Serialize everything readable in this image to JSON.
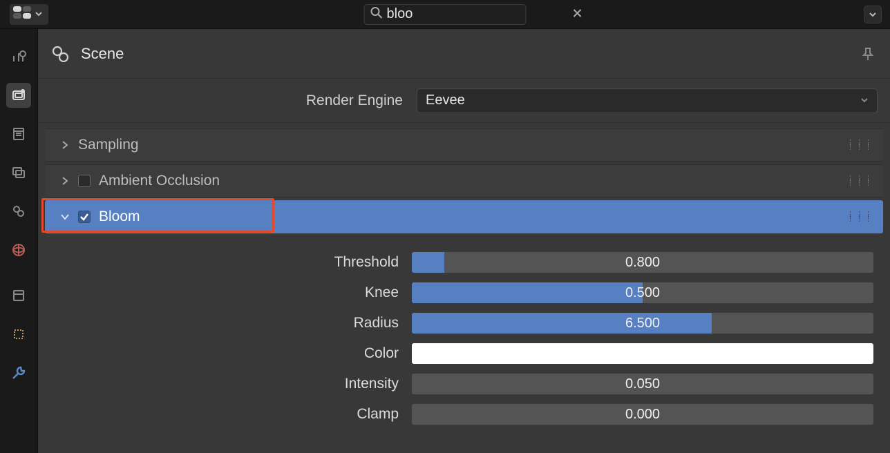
{
  "search": {
    "value": "bloo"
  },
  "context": {
    "title": "Scene"
  },
  "engine": {
    "label": "Render Engine",
    "value": "Eevee"
  },
  "panels": {
    "sampling": {
      "title": "Sampling"
    },
    "ao": {
      "title": "Ambient Occlusion"
    },
    "bloom": {
      "title": "Bloom"
    }
  },
  "bloom_props": {
    "threshold": {
      "label": "Threshold",
      "value": "0.800",
      "fill_pct": 7
    },
    "knee": {
      "label": "Knee",
      "value": "0.500",
      "fill_pct": 50
    },
    "radius": {
      "label": "Radius",
      "value": "6.500",
      "fill_pct": 65
    },
    "color": {
      "label": "Color",
      "swatch": "#ffffff"
    },
    "intensity": {
      "label": "Intensity",
      "value": "0.050"
    },
    "clamp": {
      "label": "Clamp",
      "value": "0.000"
    }
  },
  "rail_items": [
    "tools",
    "render",
    "output",
    "view-layers",
    "scene",
    "world",
    "object",
    "empty",
    "wrench"
  ]
}
